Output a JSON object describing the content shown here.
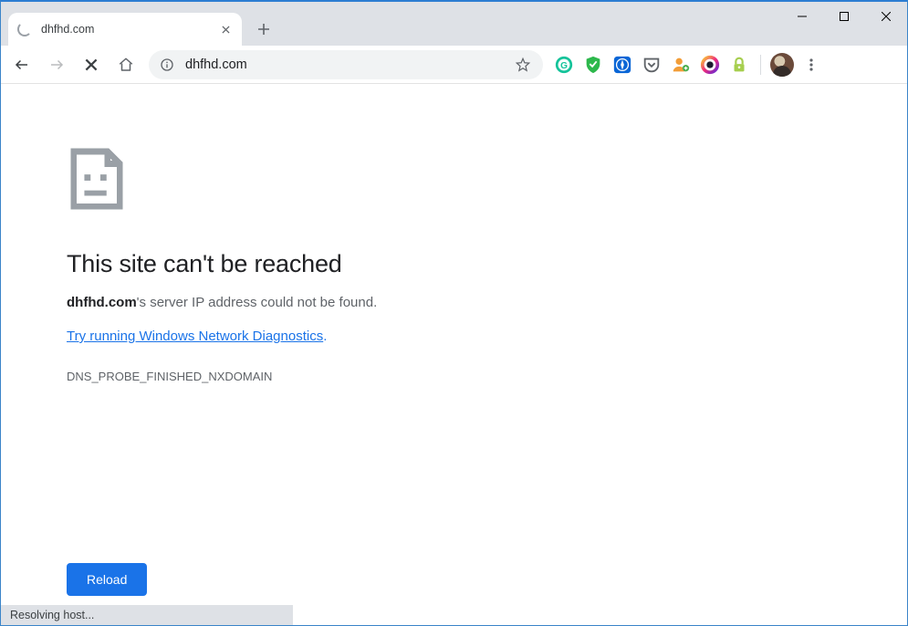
{
  "tab": {
    "title": "dhfhd.com"
  },
  "omnibox": {
    "url": "dhfhd.com"
  },
  "error": {
    "heading": "This site can't be reached",
    "domain": "dhfhd.com",
    "message_suffix": "'s server IP address could not be found.",
    "diagnostics_link": "Try running Windows Network Diagnostics",
    "diagnostics_link_suffix": ".",
    "error_code": "DNS_PROBE_FINISHED_NXDOMAIN",
    "reload_label": "Reload"
  },
  "status": {
    "text": "Resolving host..."
  },
  "extensions": [
    {
      "name": "grammarly",
      "letter": "G",
      "bg": "#ffffff",
      "fg": "#15c39a",
      "ring": "#15c39a"
    },
    {
      "name": "adguard",
      "shape": "shield",
      "fill": "#2db84c"
    },
    {
      "name": "safari-ext",
      "shape": "square",
      "fill": "#0a66d6"
    },
    {
      "name": "pocket",
      "shape": "pocket",
      "fill": "#5f6368"
    },
    {
      "name": "contacts",
      "shape": "person",
      "fill": "#f29d38",
      "accent": "#4caf50"
    },
    {
      "name": "instagram",
      "shape": "gradient-ring"
    },
    {
      "name": "lastpass",
      "shape": "lock",
      "fill": "#7cb342"
    }
  ]
}
